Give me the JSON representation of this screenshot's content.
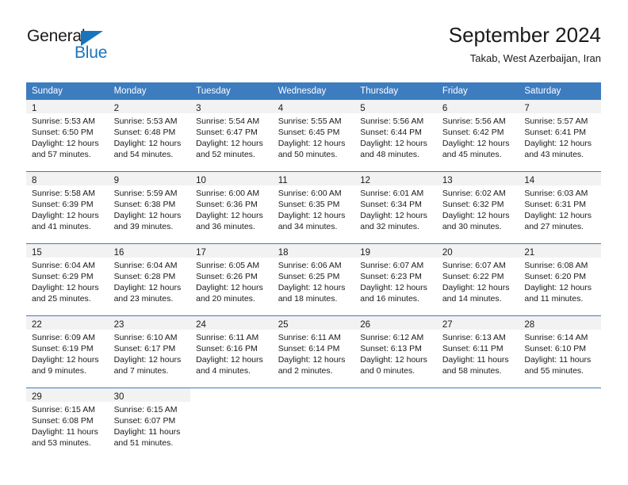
{
  "logo": {
    "text_top": "General",
    "text_bottom": "Blue",
    "triangle_color": "#1a73bd",
    "top_color": "#1a1a1a",
    "bottom_color": "#1a73bd"
  },
  "header": {
    "title": "September 2024",
    "subtitle": "Takab, West Azerbaijan, Iran"
  },
  "theme": {
    "header_bg": "#3d7cbf",
    "header_text": "#ffffff",
    "daynum_band_bg": "#f2f2f2",
    "week_separator": "#3d7cbf",
    "body_text": "#1a1a1a"
  },
  "weekday_headers": [
    "Sunday",
    "Monday",
    "Tuesday",
    "Wednesday",
    "Thursday",
    "Friday",
    "Saturday"
  ],
  "labels": {
    "sunrise_prefix": "Sunrise:",
    "sunset_prefix": "Sunset:",
    "daylight_prefix": "Daylight:"
  },
  "weeks": [
    [
      {
        "day": "1",
        "sunrise": "Sunrise: 5:53 AM",
        "sunset": "Sunset: 6:50 PM",
        "daylight_line1": "Daylight: 12 hours",
        "daylight_line2": "and 57 minutes."
      },
      {
        "day": "2",
        "sunrise": "Sunrise: 5:53 AM",
        "sunset": "Sunset: 6:48 PM",
        "daylight_line1": "Daylight: 12 hours",
        "daylight_line2": "and 54 minutes."
      },
      {
        "day": "3",
        "sunrise": "Sunrise: 5:54 AM",
        "sunset": "Sunset: 6:47 PM",
        "daylight_line1": "Daylight: 12 hours",
        "daylight_line2": "and 52 minutes."
      },
      {
        "day": "4",
        "sunrise": "Sunrise: 5:55 AM",
        "sunset": "Sunset: 6:45 PM",
        "daylight_line1": "Daylight: 12 hours",
        "daylight_line2": "and 50 minutes."
      },
      {
        "day": "5",
        "sunrise": "Sunrise: 5:56 AM",
        "sunset": "Sunset: 6:44 PM",
        "daylight_line1": "Daylight: 12 hours",
        "daylight_line2": "and 48 minutes."
      },
      {
        "day": "6",
        "sunrise": "Sunrise: 5:56 AM",
        "sunset": "Sunset: 6:42 PM",
        "daylight_line1": "Daylight: 12 hours",
        "daylight_line2": "and 45 minutes."
      },
      {
        "day": "7",
        "sunrise": "Sunrise: 5:57 AM",
        "sunset": "Sunset: 6:41 PM",
        "daylight_line1": "Daylight: 12 hours",
        "daylight_line2": "and 43 minutes."
      }
    ],
    [
      {
        "day": "8",
        "sunrise": "Sunrise: 5:58 AM",
        "sunset": "Sunset: 6:39 PM",
        "daylight_line1": "Daylight: 12 hours",
        "daylight_line2": "and 41 minutes."
      },
      {
        "day": "9",
        "sunrise": "Sunrise: 5:59 AM",
        "sunset": "Sunset: 6:38 PM",
        "daylight_line1": "Daylight: 12 hours",
        "daylight_line2": "and 39 minutes."
      },
      {
        "day": "10",
        "sunrise": "Sunrise: 6:00 AM",
        "sunset": "Sunset: 6:36 PM",
        "daylight_line1": "Daylight: 12 hours",
        "daylight_line2": "and 36 minutes."
      },
      {
        "day": "11",
        "sunrise": "Sunrise: 6:00 AM",
        "sunset": "Sunset: 6:35 PM",
        "daylight_line1": "Daylight: 12 hours",
        "daylight_line2": "and 34 minutes."
      },
      {
        "day": "12",
        "sunrise": "Sunrise: 6:01 AM",
        "sunset": "Sunset: 6:34 PM",
        "daylight_line1": "Daylight: 12 hours",
        "daylight_line2": "and 32 minutes."
      },
      {
        "day": "13",
        "sunrise": "Sunrise: 6:02 AM",
        "sunset": "Sunset: 6:32 PM",
        "daylight_line1": "Daylight: 12 hours",
        "daylight_line2": "and 30 minutes."
      },
      {
        "day": "14",
        "sunrise": "Sunrise: 6:03 AM",
        "sunset": "Sunset: 6:31 PM",
        "daylight_line1": "Daylight: 12 hours",
        "daylight_line2": "and 27 minutes."
      }
    ],
    [
      {
        "day": "15",
        "sunrise": "Sunrise: 6:04 AM",
        "sunset": "Sunset: 6:29 PM",
        "daylight_line1": "Daylight: 12 hours",
        "daylight_line2": "and 25 minutes."
      },
      {
        "day": "16",
        "sunrise": "Sunrise: 6:04 AM",
        "sunset": "Sunset: 6:28 PM",
        "daylight_line1": "Daylight: 12 hours",
        "daylight_line2": "and 23 minutes."
      },
      {
        "day": "17",
        "sunrise": "Sunrise: 6:05 AM",
        "sunset": "Sunset: 6:26 PM",
        "daylight_line1": "Daylight: 12 hours",
        "daylight_line2": "and 20 minutes."
      },
      {
        "day": "18",
        "sunrise": "Sunrise: 6:06 AM",
        "sunset": "Sunset: 6:25 PM",
        "daylight_line1": "Daylight: 12 hours",
        "daylight_line2": "and 18 minutes."
      },
      {
        "day": "19",
        "sunrise": "Sunrise: 6:07 AM",
        "sunset": "Sunset: 6:23 PM",
        "daylight_line1": "Daylight: 12 hours",
        "daylight_line2": "and 16 minutes."
      },
      {
        "day": "20",
        "sunrise": "Sunrise: 6:07 AM",
        "sunset": "Sunset: 6:22 PM",
        "daylight_line1": "Daylight: 12 hours",
        "daylight_line2": "and 14 minutes."
      },
      {
        "day": "21",
        "sunrise": "Sunrise: 6:08 AM",
        "sunset": "Sunset: 6:20 PM",
        "daylight_line1": "Daylight: 12 hours",
        "daylight_line2": "and 11 minutes."
      }
    ],
    [
      {
        "day": "22",
        "sunrise": "Sunrise: 6:09 AM",
        "sunset": "Sunset: 6:19 PM",
        "daylight_line1": "Daylight: 12 hours",
        "daylight_line2": "and 9 minutes."
      },
      {
        "day": "23",
        "sunrise": "Sunrise: 6:10 AM",
        "sunset": "Sunset: 6:17 PM",
        "daylight_line1": "Daylight: 12 hours",
        "daylight_line2": "and 7 minutes."
      },
      {
        "day": "24",
        "sunrise": "Sunrise: 6:11 AM",
        "sunset": "Sunset: 6:16 PM",
        "daylight_line1": "Daylight: 12 hours",
        "daylight_line2": "and 4 minutes."
      },
      {
        "day": "25",
        "sunrise": "Sunrise: 6:11 AM",
        "sunset": "Sunset: 6:14 PM",
        "daylight_line1": "Daylight: 12 hours",
        "daylight_line2": "and 2 minutes."
      },
      {
        "day": "26",
        "sunrise": "Sunrise: 6:12 AM",
        "sunset": "Sunset: 6:13 PM",
        "daylight_line1": "Daylight: 12 hours",
        "daylight_line2": "and 0 minutes."
      },
      {
        "day": "27",
        "sunrise": "Sunrise: 6:13 AM",
        "sunset": "Sunset: 6:11 PM",
        "daylight_line1": "Daylight: 11 hours",
        "daylight_line2": "and 58 minutes."
      },
      {
        "day": "28",
        "sunrise": "Sunrise: 6:14 AM",
        "sunset": "Sunset: 6:10 PM",
        "daylight_line1": "Daylight: 11 hours",
        "daylight_line2": "and 55 minutes."
      }
    ],
    [
      {
        "day": "29",
        "sunrise": "Sunrise: 6:15 AM",
        "sunset": "Sunset: 6:08 PM",
        "daylight_line1": "Daylight: 11 hours",
        "daylight_line2": "and 53 minutes."
      },
      {
        "day": "30",
        "sunrise": "Sunrise: 6:15 AM",
        "sunset": "Sunset: 6:07 PM",
        "daylight_line1": "Daylight: 11 hours",
        "daylight_line2": "and 51 minutes."
      },
      {
        "day": "",
        "sunrise": "",
        "sunset": "",
        "daylight_line1": "",
        "daylight_line2": ""
      },
      {
        "day": "",
        "sunrise": "",
        "sunset": "",
        "daylight_line1": "",
        "daylight_line2": ""
      },
      {
        "day": "",
        "sunrise": "",
        "sunset": "",
        "daylight_line1": "",
        "daylight_line2": ""
      },
      {
        "day": "",
        "sunrise": "",
        "sunset": "",
        "daylight_line1": "",
        "daylight_line2": ""
      },
      {
        "day": "",
        "sunrise": "",
        "sunset": "",
        "daylight_line1": "",
        "daylight_line2": ""
      }
    ]
  ]
}
